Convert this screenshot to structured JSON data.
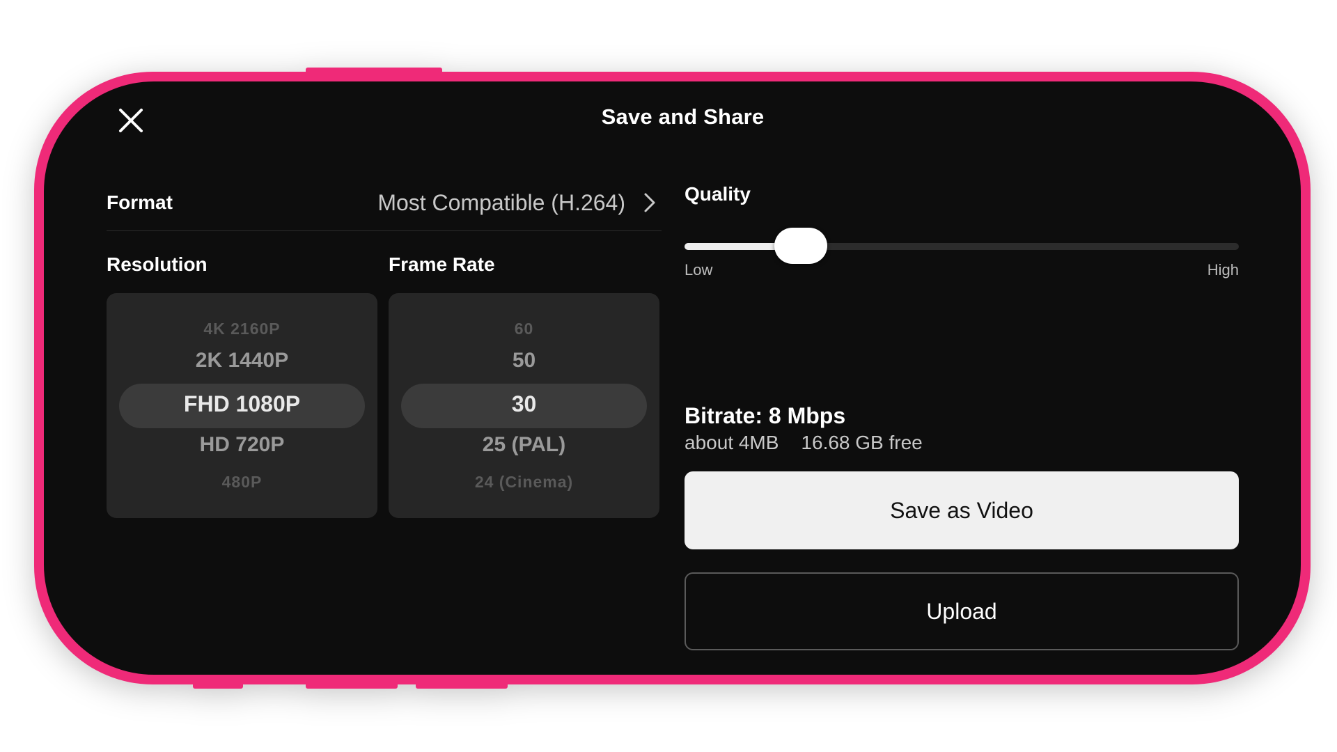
{
  "header": {
    "title": "Save and Share",
    "close_icon": "close-icon"
  },
  "format": {
    "label": "Format",
    "value": "Most Compatible (H.264)",
    "chevron_icon": "chevron-right-icon"
  },
  "resolution": {
    "label": "Resolution",
    "options": [
      "4K 2160P",
      "2K 1440P",
      "FHD 1080P",
      "HD 720P",
      "480P"
    ],
    "selected": "FHD 1080P"
  },
  "frame_rate": {
    "label": "Frame Rate",
    "options": [
      "60",
      "50",
      "30",
      "25 (PAL)",
      "24 (Cinema)"
    ],
    "selected": "30"
  },
  "quality": {
    "label": "Quality",
    "level": 0.21,
    "low_label": "Low",
    "high_label": "High"
  },
  "bitrate": {
    "text": "Bitrate: 8 Mbps",
    "size_estimate": "about 4MB",
    "free_space": "16.68 GB free"
  },
  "actions": {
    "save_label": "Save as Video",
    "upload_label": "Upload"
  },
  "colors": {
    "frame": "#ef2a78",
    "screen_bg": "#0d0d0d",
    "picker_bg": "#262626",
    "picker_highlight": "#3b3b3b",
    "save_button_bg": "#f0f0f0"
  }
}
